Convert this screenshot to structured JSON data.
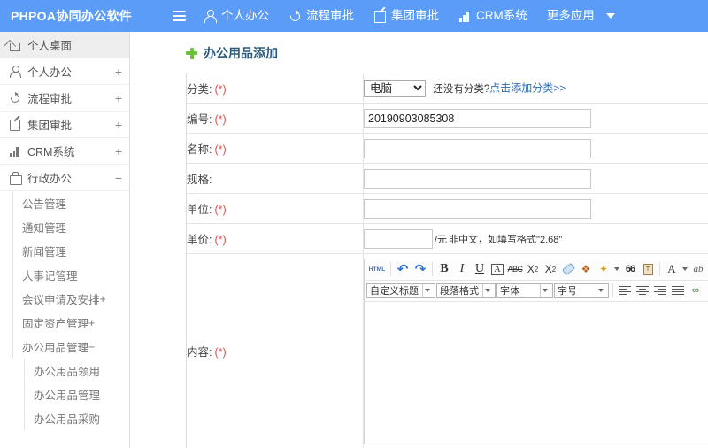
{
  "topbar": {
    "brand": "PHPOA协同办公软件",
    "menu_icon": "hamburger-icon",
    "nav": [
      {
        "label": "个人办公",
        "icon": "user-icon"
      },
      {
        "label": "流程审批",
        "icon": "flow-icon"
      },
      {
        "label": "集团审批",
        "icon": "edit-icon"
      },
      {
        "label": "CRM系统",
        "icon": "chart-icon"
      },
      {
        "label": "更多应用",
        "icon": "none"
      }
    ],
    "more_caret": "▼",
    "bg_color": "#5a9cf8"
  },
  "sidebar": {
    "items": [
      {
        "label": "个人桌面",
        "icon": "home-icon",
        "toggle": "",
        "active": true
      },
      {
        "label": "个人办公",
        "icon": "user-icon",
        "toggle": "+",
        "active": false
      },
      {
        "label": "流程审批",
        "icon": "flow-icon",
        "toggle": "+",
        "active": false
      },
      {
        "label": "集团审批",
        "icon": "edit-icon",
        "toggle": "+",
        "active": false
      },
      {
        "label": "CRM系统",
        "icon": "chart-icon",
        "toggle": "+",
        "active": false
      },
      {
        "label": "行政办公",
        "icon": "bag-icon",
        "toggle": "−",
        "active": false
      }
    ],
    "subitems": [
      {
        "label": "公告管理",
        "toggle": ""
      },
      {
        "label": "通知管理",
        "toggle": ""
      },
      {
        "label": "新闻管理",
        "toggle": ""
      },
      {
        "label": "大事记管理",
        "toggle": ""
      },
      {
        "label": "会议申请及安排",
        "toggle": "+"
      },
      {
        "label": "固定资产管理",
        "toggle": "+"
      },
      {
        "label": "办公用品管理",
        "toggle": "−"
      }
    ],
    "deepitems": [
      {
        "label": "办公用品领用"
      },
      {
        "label": "办公用品管理"
      },
      {
        "label": "办公用品采购"
      }
    ]
  },
  "page": {
    "title": "办公用品添加",
    "title_icon": "plus-icon",
    "title_color": "#2a5a7a"
  },
  "form": {
    "rows": [
      {
        "label": "分类:",
        "required": "(*)"
      },
      {
        "label": "编号:",
        "required": "(*)"
      },
      {
        "label": "名称:",
        "required": "(*)"
      },
      {
        "label": "规格:",
        "required": ""
      },
      {
        "label": "单位:",
        "required": "(*)"
      },
      {
        "label": "单价:",
        "required": "(*)"
      },
      {
        "label": "内容:",
        "required": "(*)"
      }
    ],
    "category": {
      "selected": "电脑",
      "options": [
        "电脑"
      ],
      "hint_text": "还没有分类?",
      "link_text": "点击添加分类>>",
      "link_color": "#2b6dbb"
    },
    "code": {
      "value": "20190903085308",
      "placeholder": ""
    },
    "name": {
      "value": "",
      "placeholder": ""
    },
    "spec": {
      "value": "",
      "placeholder": ""
    },
    "unit": {
      "value": "",
      "placeholder": ""
    },
    "price": {
      "value": "",
      "placeholder": "",
      "suffix": "/元",
      "hint": "非中文，如填写格式\"2.68\""
    }
  },
  "editor": {
    "toolbar_row1": [
      {
        "name": "html-source-button",
        "label": "HTML"
      },
      {
        "name": "undo-button",
        "label": "↶"
      },
      {
        "name": "redo-button",
        "label": "↷"
      },
      {
        "name": "bold-button",
        "label": "B"
      },
      {
        "name": "italic-button",
        "label": "I"
      },
      {
        "name": "underline-button",
        "label": "U"
      },
      {
        "name": "boxed-a-button",
        "label": "A"
      },
      {
        "name": "strikethrough-button",
        "label": "ABC"
      },
      {
        "name": "superscript-button",
        "label": "X²"
      },
      {
        "name": "subscript-button",
        "label": "X₂"
      },
      {
        "name": "eraser-button",
        "label": ""
      },
      {
        "name": "paintbrush-button",
        "label": ""
      },
      {
        "name": "magic-wand-button",
        "label": ""
      },
      {
        "name": "blockquote-button",
        "label": "66"
      },
      {
        "name": "paste-text-button",
        "label": "T"
      },
      {
        "name": "font-color-button",
        "label": "A"
      },
      {
        "name": "highlight-color-button",
        "label": "ab"
      }
    ],
    "toolbar_row2": {
      "custom_title": "自定义标题",
      "paragraph_format": "段落格式",
      "font_family": "字体",
      "font_size": "字号",
      "align_left": "align-left-button",
      "align_center": "align-center-button",
      "align_right": "align-right-button",
      "align_justify": "align-justify-button",
      "link": "link-button"
    },
    "body_text": ""
  }
}
